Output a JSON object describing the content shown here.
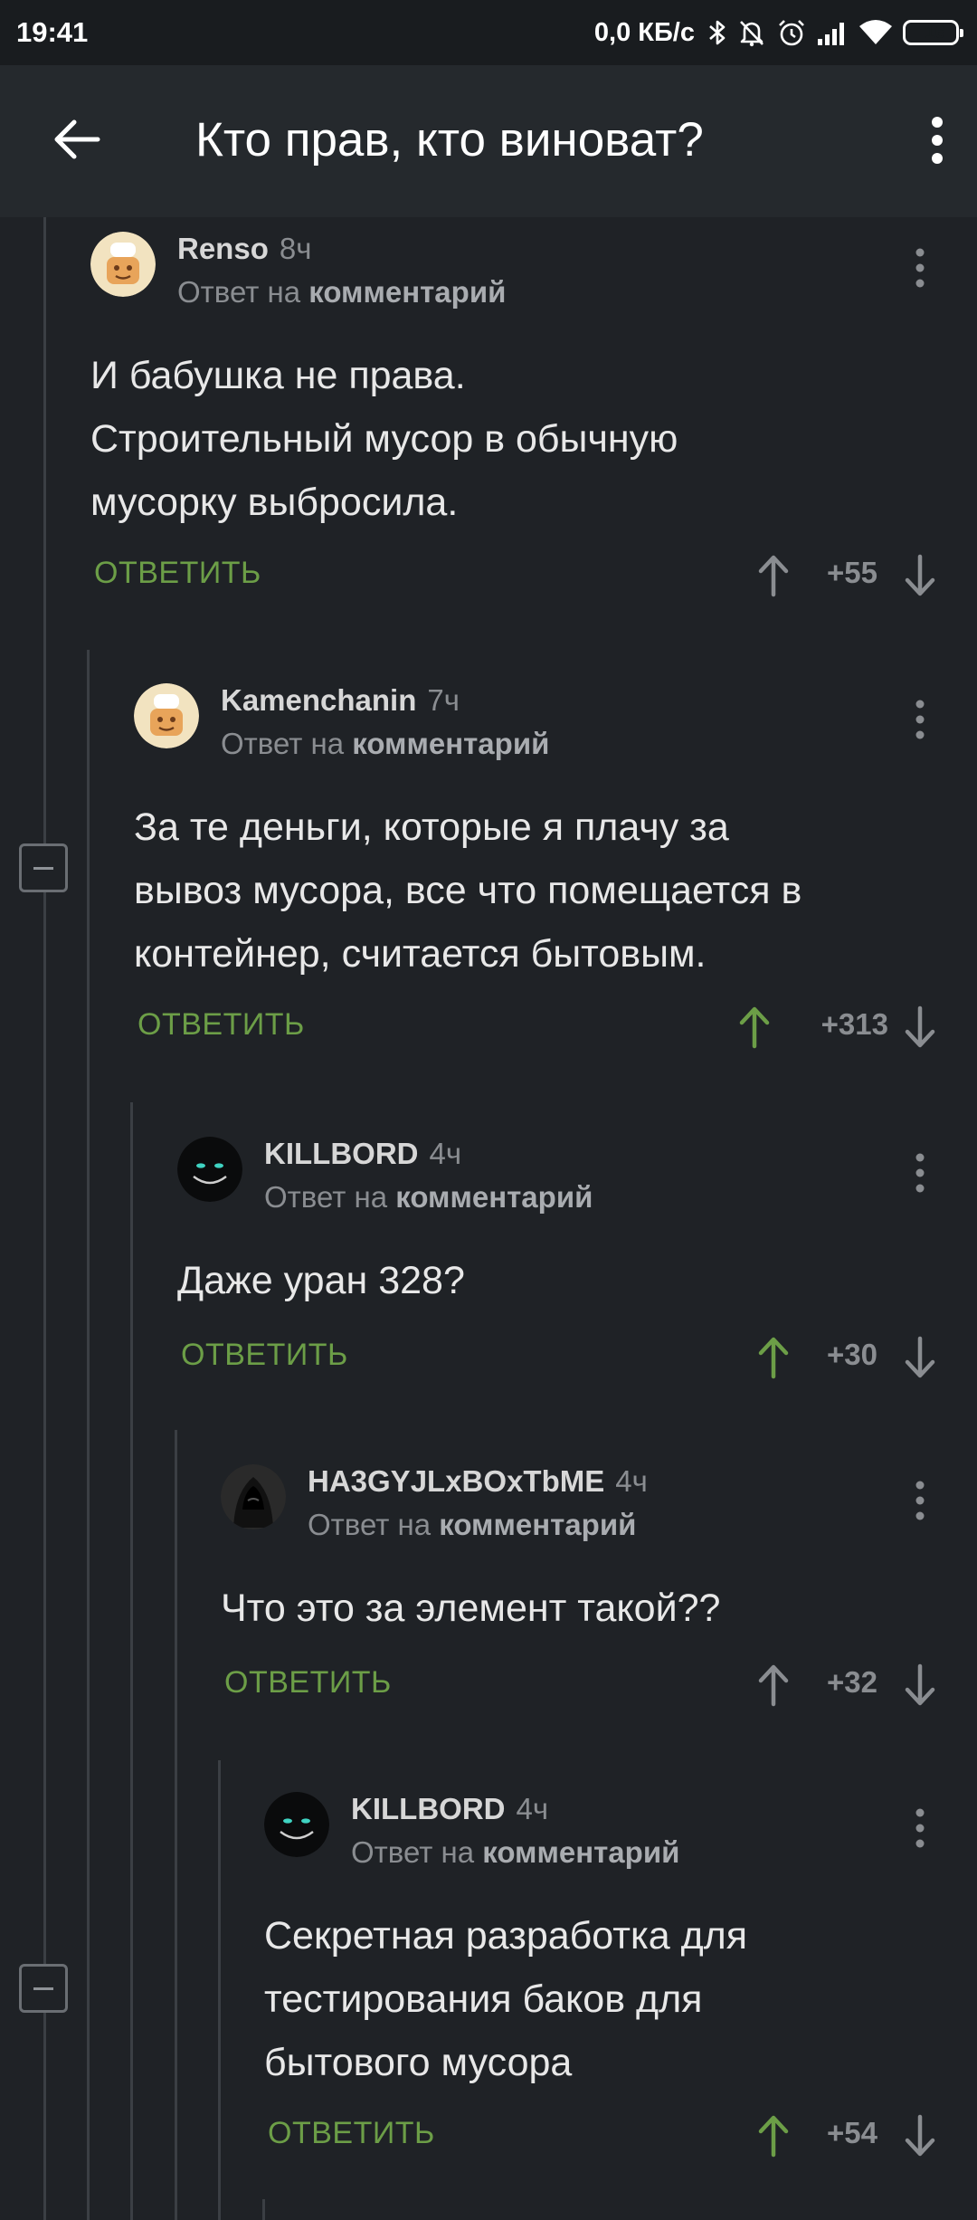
{
  "status_bar": {
    "time": "19:41",
    "net_speed": "0,0 КБ/с",
    "battery_level": "16",
    "icons": [
      "bluetooth-icon",
      "mute-icon",
      "alarm-icon",
      "signal-icon",
      "wifi-icon",
      "battery-icon"
    ]
  },
  "toolbar": {
    "title": "Кто прав, кто виноват?",
    "back_icon": "arrow-left-icon",
    "menu_icon": "more-vertical-icon"
  },
  "colors": {
    "background": "#1f2226",
    "toolbar": "#25292d",
    "accent_green": "#6c9e47",
    "muted": "#8a8d91"
  },
  "comments": [
    {
      "author": "Renso",
      "time": "8ч",
      "reply_prefix": "Ответ на",
      "reply_target": "комментарий",
      "text": "И бабушка не права.\nСтроительный мусор в обычную\nмусорку выбросила.",
      "reply_label": "ОТВЕТИТЬ",
      "score": "+55",
      "upvoted": false,
      "avatar": "chef-avatar"
    },
    {
      "author": "Kamenchanin",
      "time": "7ч",
      "reply_prefix": "Ответ на",
      "reply_target": "комментарий",
      "text": "За те деньги, которые я плачу за\nвывоз мусора, все что помещается в\nконтейнер, считается бытовым.",
      "reply_label": "ОТВЕТИТЬ",
      "score": "+313",
      "upvoted": true,
      "avatar": "chef-avatar"
    },
    {
      "author": "KILLBORD",
      "time": "4ч",
      "reply_prefix": "Ответ на",
      "reply_target": "комментарий",
      "text": "Даже уран 328?",
      "reply_label": "ОТВЕТИТЬ",
      "score": "+30",
      "upvoted": true,
      "avatar": "cat-smile-avatar"
    },
    {
      "author": "HA3GYJLxBOxTbME",
      "time": "4ч",
      "reply_prefix": "Ответ на",
      "reply_target": "комментарий",
      "text": "Что это за элемент такой??",
      "reply_label": "ОТВЕТИТЬ",
      "score": "+32",
      "upvoted": false,
      "avatar": "hooded-figure-avatar"
    },
    {
      "author": "KILLBORD",
      "time": "4ч",
      "reply_prefix": "Ответ на",
      "reply_target": "комментарий",
      "text": "Секретная разработка для\nтестирования баков для\nбытового мусора",
      "reply_label": "ОТВЕТИТЬ",
      "score": "+54",
      "upvoted": true,
      "avatar": "cat-smile-avatar"
    }
  ]
}
